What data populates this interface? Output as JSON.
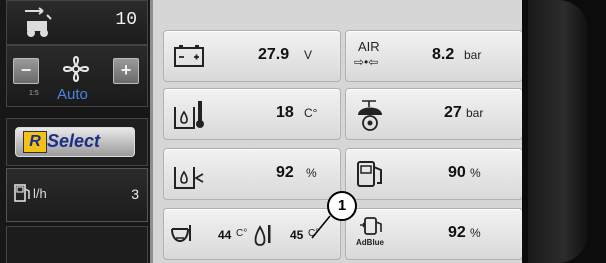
{
  "sidebar": {
    "top_value": "10",
    "fan": {
      "minus_label": "−",
      "plus_label": "+",
      "scale_text": "1:5",
      "mode_label": "Auto"
    },
    "select": {
      "r_label": "R",
      "select_label": "Select"
    },
    "fuel": {
      "label": "l/h",
      "value": "3"
    }
  },
  "tiles": {
    "battery": {
      "value": "27.9",
      "unit": "V",
      "icon": "battery-icon"
    },
    "air": {
      "icon_text": "AIR",
      "value": "8.2",
      "unit": "bar",
      "icon": "air-pressure-icon"
    },
    "coolant_temp": {
      "value": "18",
      "unit": "C°",
      "icon": "coolant-temperature-icon"
    },
    "oil_pressure": {
      "value": "27",
      "unit": "bar",
      "icon": "oil-pressure-icon"
    },
    "coolant_level": {
      "value": "92",
      "unit": "%",
      "icon": "coolant-level-icon"
    },
    "fuel_level": {
      "value": "90",
      "unit": "%",
      "icon": "fuel-level-icon"
    },
    "oil_temps": {
      "value_1": "44",
      "unit_1": "C°",
      "value_2": "45",
      "unit_2": "C°",
      "icon": "oil-temperature-icon"
    },
    "adblue": {
      "value": "92",
      "unit": "%",
      "icon_text": "AdBlue",
      "icon": "adblue-icon"
    }
  },
  "callout": {
    "label": "1"
  },
  "colors": {
    "panel_bg": "#d6d6d6",
    "sidebar_bg": "#171717",
    "auto_blue": "#4a83e0",
    "select_yellow": "#f3c21a"
  }
}
